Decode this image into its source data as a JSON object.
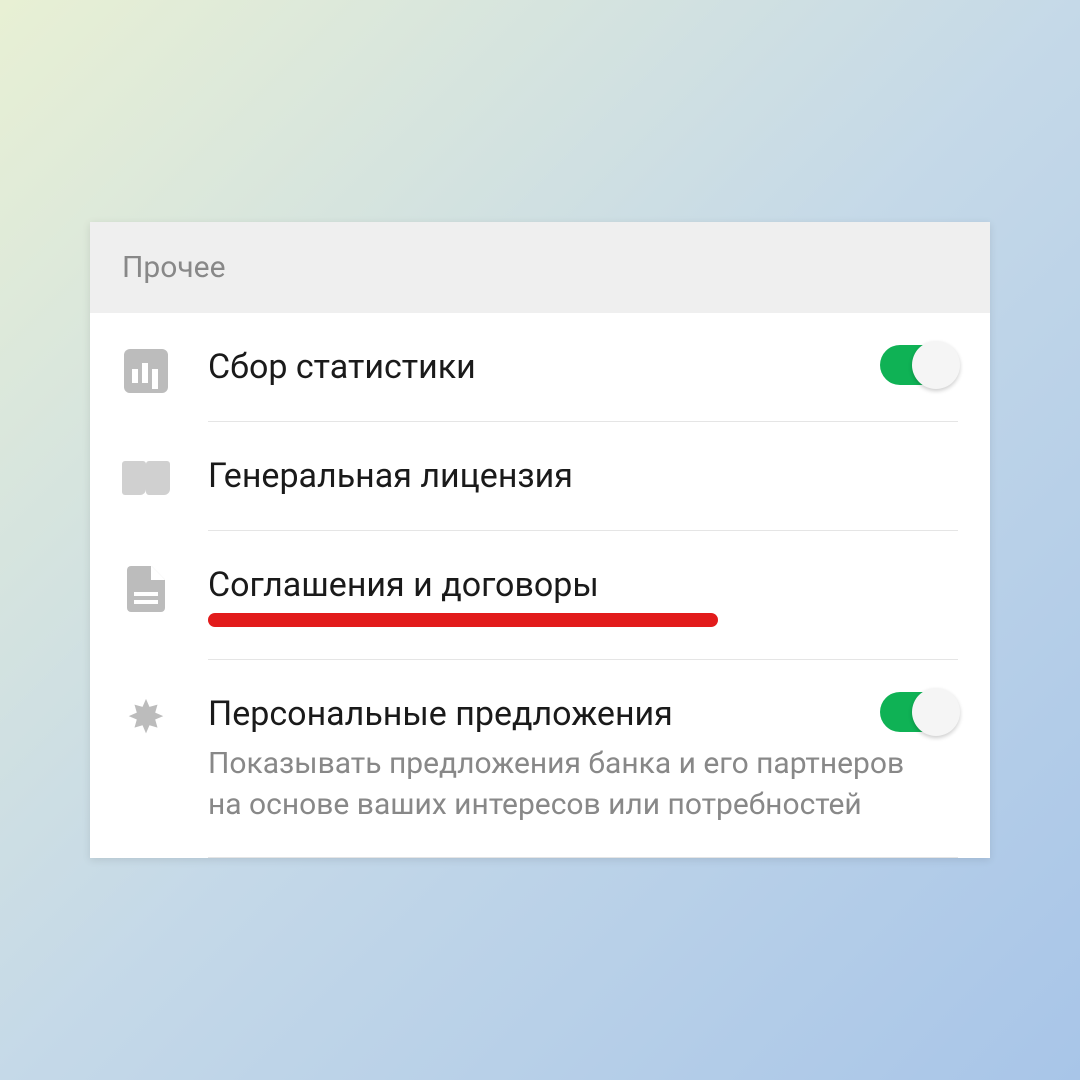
{
  "section_title": "Прочее",
  "items": [
    {
      "icon": "stats-icon",
      "title": "Сбор статистики",
      "has_toggle": true,
      "toggle_on": true
    },
    {
      "icon": "book-icon",
      "title": "Генеральная лицензия"
    },
    {
      "icon": "document-icon",
      "title": "Соглашения и договоры",
      "highlighted": true
    },
    {
      "icon": "burst-icon",
      "title": "Персональные предложения",
      "subtitle": "Показывать предложения банка и его партнеров на основе ваших интересов или потребностей",
      "has_toggle": true,
      "toggle_on": true
    }
  ],
  "colors": {
    "toggle_on": "#0fb255",
    "highlight": "#e21b1b"
  }
}
